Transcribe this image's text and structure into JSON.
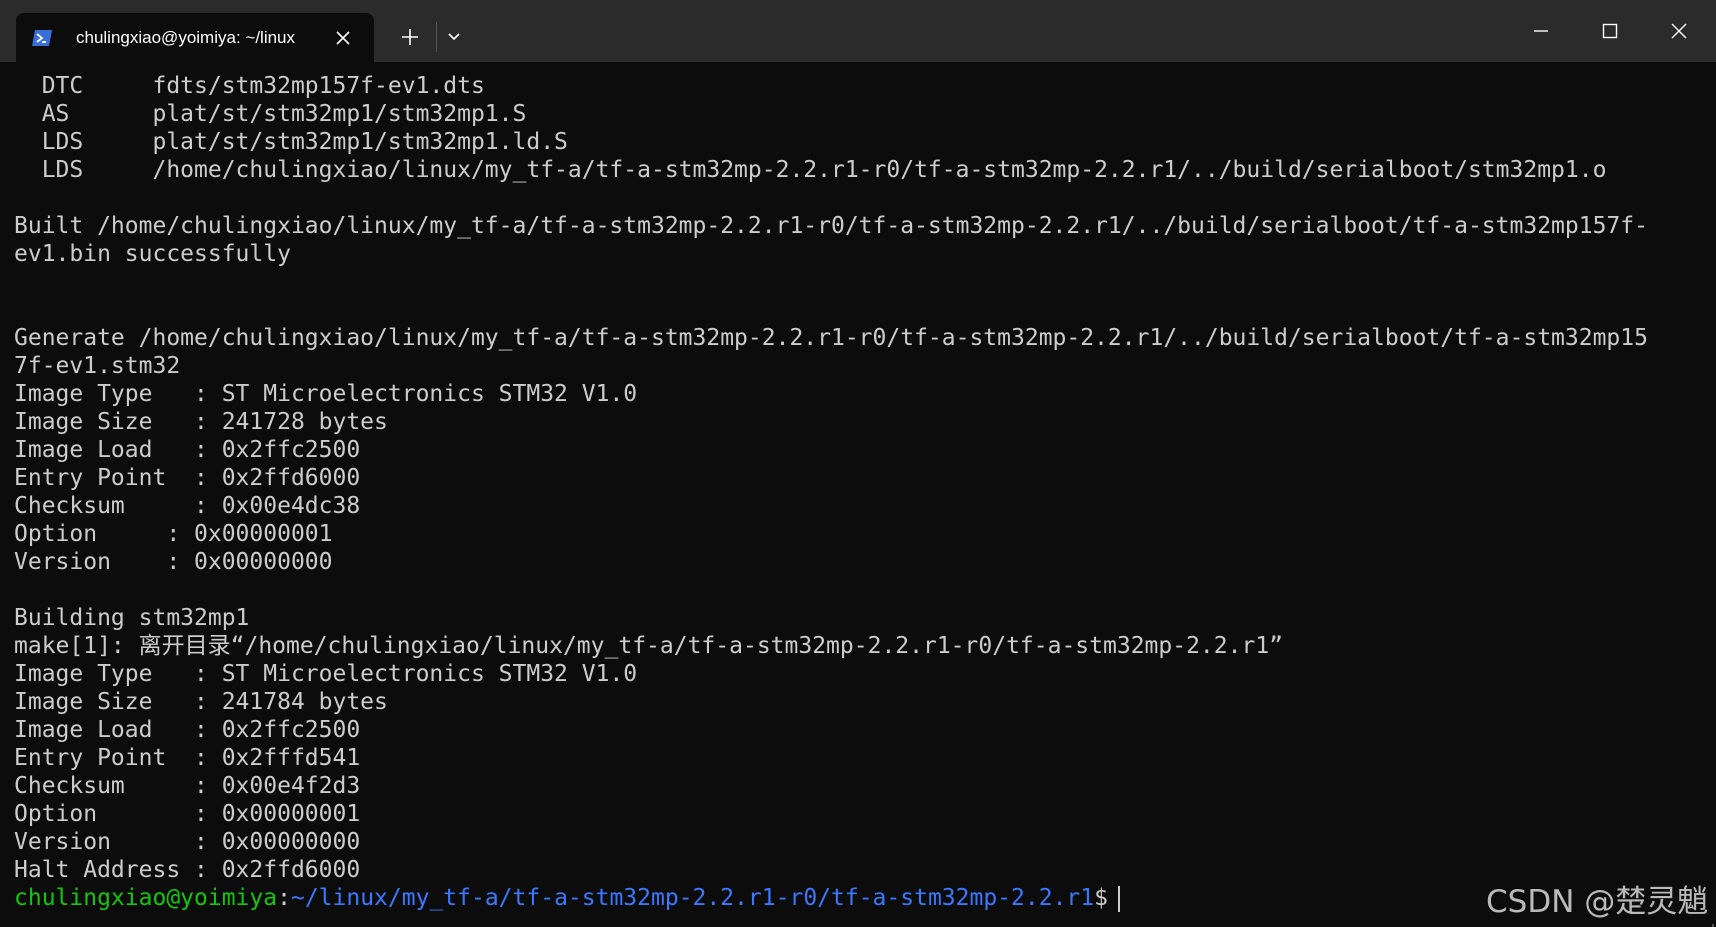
{
  "window": {
    "tab_title": "chulingxiao@yoimiya: ~/linux",
    "tab_icon": "terminal-prompt-icon",
    "new_tab_icon": "plus-icon",
    "dropdown_icon": "chevron-down-icon",
    "controls": [
      "minimize-icon",
      "maximize-icon",
      "close-icon"
    ]
  },
  "terminal": {
    "lines": [
      "  DTC     fdts/stm32mp157f-ev1.dts",
      "  AS      plat/st/stm32mp1/stm32mp1.S",
      "  LDS     plat/st/stm32mp1/stm32mp1.ld.S",
      "  LDS     /home/chulingxiao/linux/my_tf-a/tf-a-stm32mp-2.2.r1-r0/tf-a-stm32mp-2.2.r1/../build/serialboot/stm32mp1.o",
      "",
      "Built /home/chulingxiao/linux/my_tf-a/tf-a-stm32mp-2.2.r1-r0/tf-a-stm32mp-2.2.r1/../build/serialboot/tf-a-stm32mp157f-",
      "ev1.bin successfully",
      "",
      "",
      "Generate /home/chulingxiao/linux/my_tf-a/tf-a-stm32mp-2.2.r1-r0/tf-a-stm32mp-2.2.r1/../build/serialboot/tf-a-stm32mp15",
      "7f-ev1.stm32",
      "Image Type   : ST Microelectronics STM32 V1.0",
      "Image Size   : 241728 bytes",
      "Image Load   : 0x2ffc2500",
      "Entry Point  : 0x2ffd6000",
      "Checksum     : 0x00e4dc38",
      "Option     : 0x00000001",
      "Version    : 0x00000000",
      "",
      "Building stm32mp1",
      "make[1]: 离开目录“/home/chulingxiao/linux/my_tf-a/tf-a-stm32mp-2.2.r1-r0/tf-a-stm32mp-2.2.r1”",
      "Image Type   : ST Microelectronics STM32 V1.0",
      "Image Size   : 241784 bytes",
      "Image Load   : 0x2ffc2500",
      "Entry Point  : 0x2fffd541",
      "Checksum     : 0x00e4f2d3",
      "Option       : 0x00000001",
      "Version      : 0x00000000",
      "Halt Address : 0x2ffd6000"
    ],
    "prompt": {
      "user_host": "chulingxiao@yoimiya",
      "colon": ":",
      "path": "~/linux/my_tf-a/tf-a-stm32mp-2.2.r1-r0/tf-a-stm32mp-2.2.r1",
      "symbol": "$"
    }
  },
  "watermark": "CSDN @楚灵魈",
  "colors": {
    "background": "#0c0c0c",
    "titlebar": "#2b2b2b",
    "text": "#cccccc",
    "prompt_user": "#16c60c",
    "prompt_path": "#3b78ff"
  }
}
